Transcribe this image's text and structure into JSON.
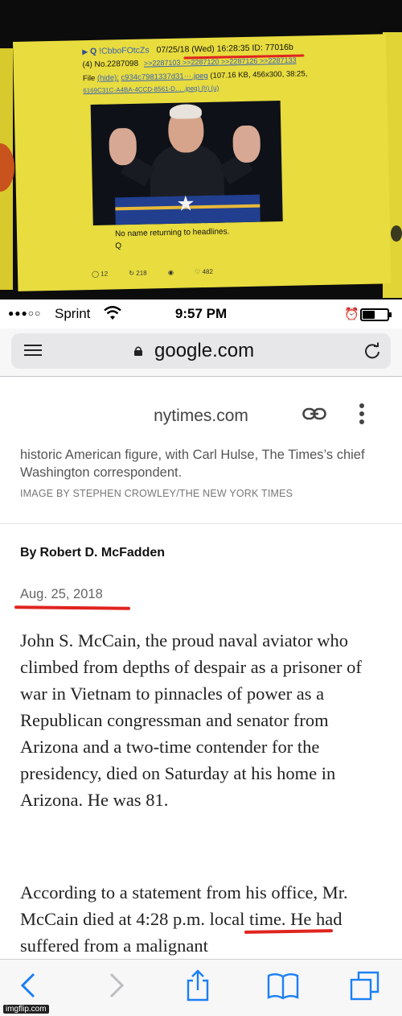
{
  "photo": {
    "post_header": {
      "name_prefix": "Q",
      "tripcode": "!CbboFOtcZs",
      "datetime": "07/25/18 (Wed) 16:28:35",
      "id_label": "ID: 77016b"
    },
    "post_number": "(4) No.2287098",
    "reply_links": ">>2287103 >>2287120 >>2287126 >>2287133",
    "file_label": "File",
    "file_hide": "(hide):",
    "file_name": "c934c7981337d31···.jpeg",
    "file_info": "(107.16 KB, 456x300, 38:25,",
    "file_hash": "6169C31C-A4BA-4CCD-8561-D… .jpeg) (h) (u)",
    "post_text": "No name returning to headlines.",
    "signature": "Q",
    "stats": [
      "12",
      "218",
      "482"
    ]
  },
  "status_bar": {
    "carrier": "Sprint",
    "time": "9:57 PM",
    "battery_level": 0.5
  },
  "url_bar": {
    "domain": "google.com"
  },
  "amp_header": {
    "site": "nytimes.com"
  },
  "article": {
    "caption": "historic American figure, with Carl Hulse, The Times’s chief Washington correspondent.",
    "image_credit": "IMAGE BY STEPHEN CROWLEY/THE NEW YORK TIMES",
    "byline_prefix": "By",
    "author": "Robert D. McFadden",
    "date": "Aug. 25, 2018",
    "paragraph_1": "John S. McCain, the proud naval aviator who climbed from depths of despair as a prisoner of war in Vietnam to pinnacles of power as a Republican congressman and senator from Arizona and a two-time contender for the presidency, died on Saturday at his home in Arizona. He was 81.",
    "paragraph_2": "According to a statement from his office, Mr. McCain died at 4:28 p.m. local time. He had suffered from a malignant"
  },
  "toolbar": {
    "icons": [
      "back-icon",
      "forward-icon",
      "share-icon",
      "bookmarks-icon",
      "tabs-icon"
    ]
  },
  "colors": {
    "annotation_red": "#e0241f",
    "chan_yellow": "#e8dc3f",
    "ios_blue": "#1a7ff6"
  },
  "watermark": "imgflip.com"
}
